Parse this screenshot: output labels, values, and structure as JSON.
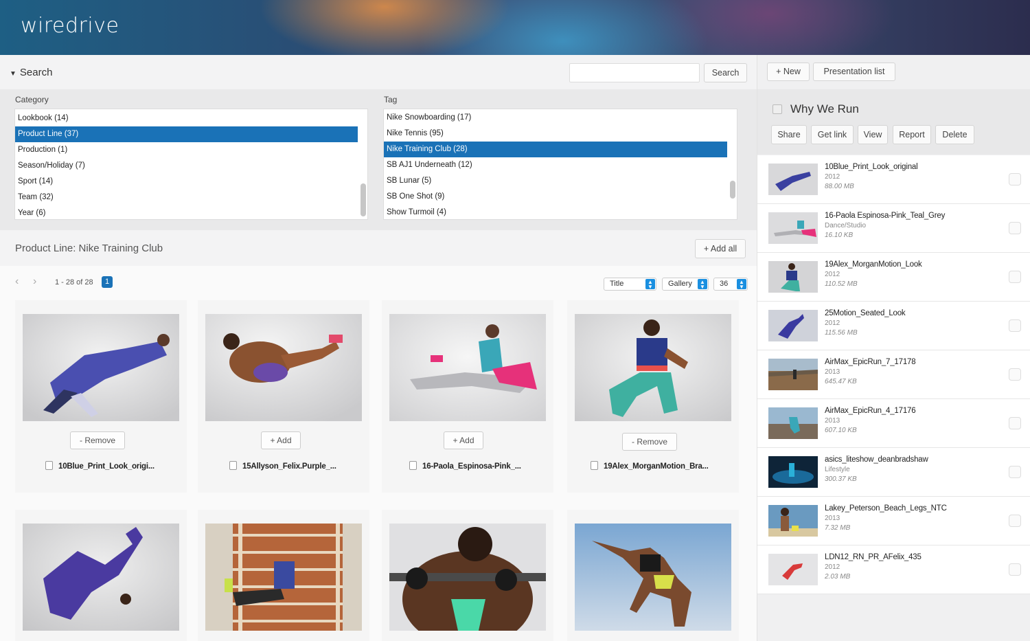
{
  "app": {
    "logo": "wiredrive"
  },
  "search": {
    "toggle_label": "Search",
    "input_value": "",
    "button": "Search"
  },
  "filters": {
    "category_label": "Category",
    "tag_label": "Tag",
    "categories": [
      "Lookbook (14)",
      "Product Line (37)",
      "Production (1)",
      "Season/Holiday (7)",
      "Sport (14)",
      "Team (32)",
      "Year (6)"
    ],
    "selected_category": "Product Line (37)",
    "tags": [
      "Nike Snowboarding (17)",
      "Nike Tennis (95)",
      "Nike Training Club (28)",
      "SB AJ1 Underneath (12)",
      "SB Lunar (5)",
      "SB One Shot (9)",
      "Show Turmoil (4)"
    ],
    "selected_tag": "Nike Training Club (28)"
  },
  "product": {
    "title": "Product Line: Nike Training Club",
    "add_all": "+ Add all"
  },
  "pager": {
    "text": "1 - 28 of 28",
    "page": "1",
    "sort": "Title",
    "view": "Gallery",
    "per_page": "36"
  },
  "gallery": [
    {
      "button": "- Remove",
      "name": "10Blue_Print_Look_origi..."
    },
    {
      "button": "+ Add",
      "name": "15Allyson_Felix.Purple_..."
    },
    {
      "button": "+ Add",
      "name": "16-Paola_Espinosa-Pink_..."
    },
    {
      "button": "- Remove",
      "name": "19Alex_MorganMotion_Bra..."
    },
    {
      "button": "",
      "name": ""
    },
    {
      "button": "",
      "name": ""
    },
    {
      "button": "",
      "name": ""
    },
    {
      "button": "",
      "name": ""
    }
  ],
  "presentation": {
    "new_button": "+ New",
    "list_button": "Presentation list",
    "title": "Why We Run",
    "actions": [
      "Share",
      "Get link",
      "View",
      "Report",
      "Delete"
    ],
    "items": [
      {
        "name": "10Blue_Print_Look_original",
        "meta": "2012",
        "size": "88.00 MB"
      },
      {
        "name": "16-Paola Espinosa-Pink_Teal_Grey",
        "meta": "Dance/Studio",
        "size": "16.10 KB"
      },
      {
        "name": "19Alex_MorganMotion_Look",
        "meta": "2012",
        "size": "110.52 MB"
      },
      {
        "name": "25Motion_Seated_Look",
        "meta": "2012",
        "size": "115.56 MB"
      },
      {
        "name": "AirMax_EpicRun_7_17178",
        "meta": "2013",
        "size": "645.47 KB"
      },
      {
        "name": "AirMax_EpicRun_4_17176",
        "meta": "2013",
        "size": "607.10 KB"
      },
      {
        "name": "asics_liteshow_deanbradshaw",
        "meta": "Lifestyle",
        "size": "300.37 KB"
      },
      {
        "name": "Lakey_Peterson_Beach_Legs_NTC",
        "meta": "2013",
        "size": "7.32 MB"
      },
      {
        "name": "LDN12_RN_PR_AFelix_435",
        "meta": "2012",
        "size": "2.03 MB"
      }
    ]
  },
  "colors": {
    "accent": "#1a72b7",
    "header_start": "#1e5f84",
    "header_end": "#2c2d4e"
  }
}
